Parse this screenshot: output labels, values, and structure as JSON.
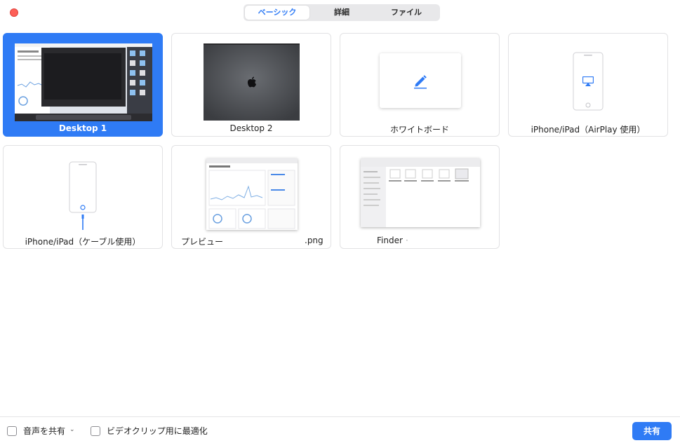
{
  "tabs": [
    {
      "label": "ベーシック",
      "active": true
    },
    {
      "label": "詳細",
      "active": false
    },
    {
      "label": "ファイル",
      "active": false
    }
  ],
  "cards": [
    {
      "label": "Desktop 1",
      "selected": true
    },
    {
      "label": "Desktop 2",
      "selected": false
    },
    {
      "label": "ホワイトボード",
      "selected": false
    },
    {
      "label": "iPhone/iPad（AirPlay 使用）",
      "selected": false
    },
    {
      "label": "iPhone/iPad（ケーブル使用）",
      "selected": false
    },
    {
      "label": "プレビュー",
      "suffix": ".png",
      "selected": false
    },
    {
      "label": "Finder",
      "suffix": "·",
      "selected": false
    }
  ],
  "bottom": {
    "share_audio": "音声を共有",
    "share_audio_chevron": "⌄",
    "optimize_video": "ビデオクリップ用に最適化",
    "share_button": "共有"
  },
  "colors": {
    "accent": "#2f7bf5",
    "close": "#fd5f57"
  }
}
